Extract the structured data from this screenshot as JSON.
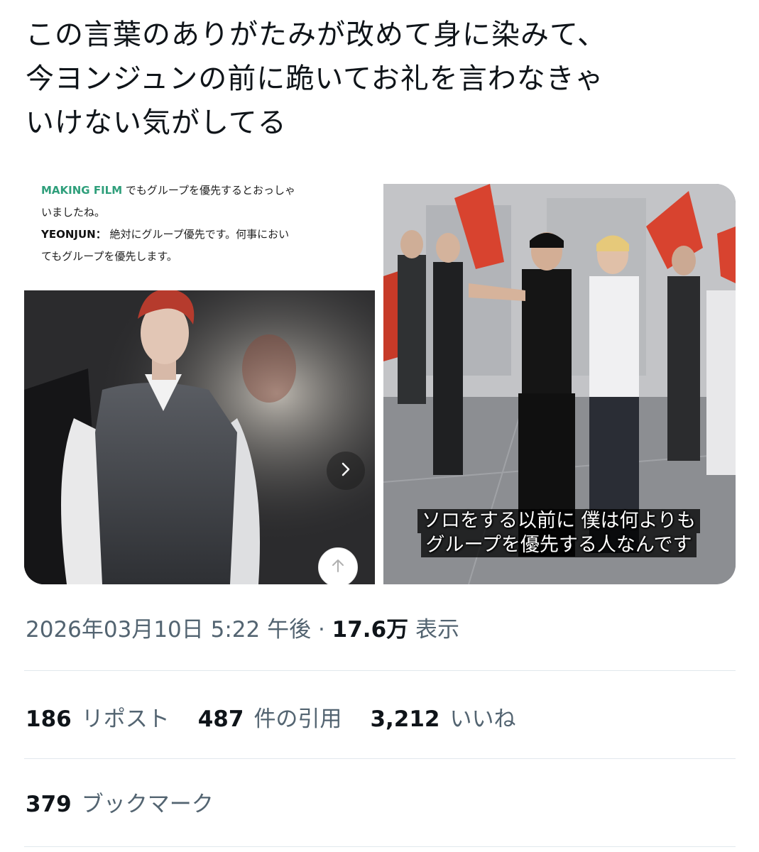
{
  "tweet": {
    "text_lines": [
      "この言葉のありがたみが改めて身に染みて、",
      "今ヨンジュンの前に跪いてお礼を言わなきゃ",
      "いけない気がしてる"
    ]
  },
  "media": {
    "left": {
      "snippet_line1_highlight": "MAKING FILM",
      "snippet_line1_rest": "でもグループを優先するとおっしゃ",
      "snippet_line2": "いましたね。",
      "snippet_speaker": "YEONJUN：",
      "snippet_line3_rest": "絶対にグループ優先です。何事におい",
      "snippet_line4": "てもグループを優先します。",
      "next_icon": "chevron-right-icon",
      "scroll_icon": "arrow-up-icon"
    },
    "right": {
      "subtitle_line1": "ソロをする以前に 僕は何よりも",
      "subtitle_line2": "グループを優先する人なんです"
    }
  },
  "meta": {
    "timestamp": "2026年03月10日 5:22 午後",
    "separator": " · ",
    "views_count": "17.6万",
    "views_label": "表示"
  },
  "stats": {
    "reposts_count": "186",
    "reposts_label": "リポスト",
    "quotes_count": "487",
    "quotes_label": "件の引用",
    "likes_count": "3,212",
    "likes_label": "いいね",
    "bookmarks_count": "379",
    "bookmarks_label": "ブックマーク"
  },
  "colors": {
    "text_primary": "#0f1419",
    "text_secondary": "#536471",
    "divider": "#e1e8ed",
    "snippet_accent": "#2f9f7b"
  }
}
